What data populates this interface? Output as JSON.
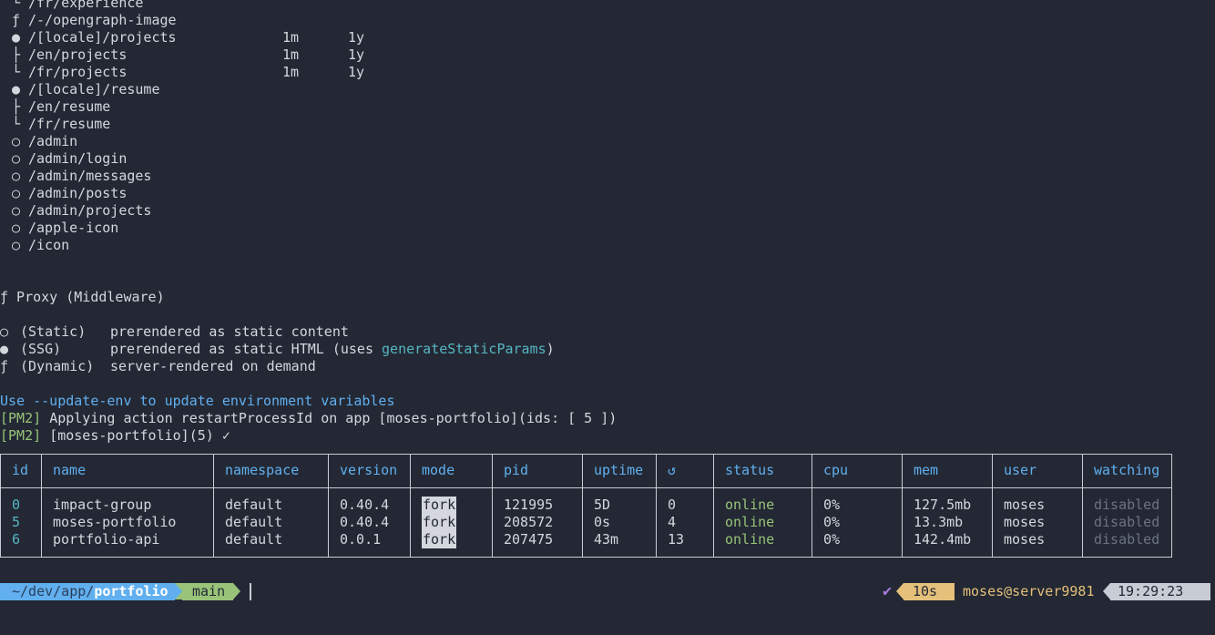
{
  "routes": [
    {
      "glyph": "└",
      "path": "/fr/experience",
      "sub": true
    },
    {
      "glyph": "ƒ",
      "path": "/-/opengraph-image",
      "sub": false
    },
    {
      "glyph": "●",
      "path": "/[locale]/projects",
      "rev": "1m",
      "exp": "1y",
      "sub": false
    },
    {
      "glyph": "├",
      "path": "/en/projects",
      "rev": "1m",
      "exp": "1y",
      "sub": true
    },
    {
      "glyph": "└",
      "path": "/fr/projects",
      "rev": "1m",
      "exp": "1y",
      "sub": true
    },
    {
      "glyph": "●",
      "path": "/[locale]/resume",
      "sub": false
    },
    {
      "glyph": "├",
      "path": "/en/resume",
      "sub": true
    },
    {
      "glyph": "└",
      "path": "/fr/resume",
      "sub": true
    },
    {
      "glyph": "○",
      "path": "/admin",
      "sub": false
    },
    {
      "glyph": "○",
      "path": "/admin/login",
      "sub": false
    },
    {
      "glyph": "○",
      "path": "/admin/messages",
      "sub": false
    },
    {
      "glyph": "○",
      "path": "/admin/posts",
      "sub": false
    },
    {
      "glyph": "○",
      "path": "/admin/projects",
      "sub": false
    },
    {
      "glyph": "○",
      "path": "/apple-icon",
      "sub": false
    },
    {
      "glyph": "○",
      "path": "/icon",
      "sub": false
    }
  ],
  "proxy": "ƒ Proxy (Middleware)",
  "legend": {
    "static": {
      "sym": "○",
      "label": "(Static)",
      "desc": "prerendered as static content"
    },
    "ssg": {
      "sym": "●",
      "label": "(SSG)",
      "desc": "prerendered as static HTML (uses ",
      "fn": "generateStaticParams",
      "tail": ")"
    },
    "dynamic": {
      "sym": "ƒ",
      "label": "(Dynamic)",
      "desc": "server-rendered on demand"
    }
  },
  "update_env": "Use --update-env to update environment variables",
  "pm2_tag": "[PM2]",
  "pm2_msg1": "Applying action restartProcessId on app [moses-portfolio](ids: [ 5 ])",
  "pm2_msg2": "[moses-portfolio](5) ✓",
  "table": {
    "headers": [
      "id",
      "name",
      "namespace",
      "version",
      "mode",
      "pid",
      "uptime",
      "↺",
      "status",
      "cpu",
      "mem",
      "user",
      "watching"
    ],
    "rows": [
      [
        "0",
        "impact-group",
        "default",
        "0.40.4",
        "fork",
        "121995",
        "5D",
        "0",
        "online",
        "0%",
        "127.5mb",
        "moses",
        "disabled"
      ],
      [
        "5",
        "moses-portfolio",
        "default",
        "0.40.4",
        "fork",
        "208572",
        "0s",
        "4",
        "online",
        "0%",
        "13.3mb",
        "moses",
        "disabled"
      ],
      [
        "6",
        "portfolio-api",
        "default",
        "0.0.1",
        "fork",
        "207475",
        "43m",
        "13",
        "online",
        "0%",
        "142.4mb",
        "moses",
        "disabled"
      ]
    ]
  },
  "prompt": {
    "path_prefix": "~/dev/app/",
    "path_dir": "portfolio",
    "branch": "main",
    "duration": "10s",
    "user_host": "moses@server9981",
    "time": "19:29:23",
    "check": "✔"
  },
  "colors": {
    "background": "#232834",
    "text": "#d4d7dd",
    "blue": "#61afef",
    "cyan": "#56b6c2",
    "green": "#98c379",
    "gray": "#6c7380",
    "prompt_blue": "#61afef",
    "prompt_green": "#98c379",
    "prompt_yellow": "#e5c07b",
    "prompt_gray": "#c8ccd4"
  }
}
